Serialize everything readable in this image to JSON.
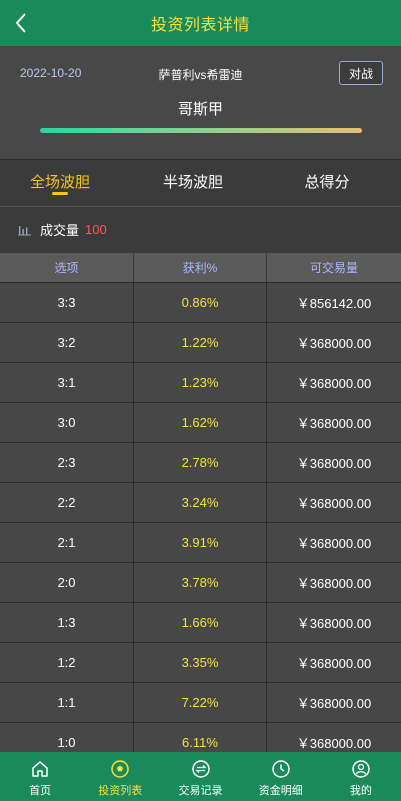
{
  "header": {
    "title": "投资列表详情"
  },
  "match": {
    "date": "2022-10-20",
    "teams": "萨普利vs希雷迪",
    "action_label": "对战",
    "league": "哥斯甲"
  },
  "tabs": [
    {
      "label": "全场波胆",
      "active": true
    },
    {
      "label": "半场波胆",
      "active": false
    },
    {
      "label": "总得分",
      "active": false
    }
  ],
  "volume": {
    "label": "成交量",
    "value": "100"
  },
  "table": {
    "headers": [
      "选项",
      "获利%",
      "可交易量"
    ],
    "rows": [
      {
        "score": "3:3",
        "profit": "0.86%",
        "amount": "￥856142.00"
      },
      {
        "score": "3:2",
        "profit": "1.22%",
        "amount": "￥368000.00"
      },
      {
        "score": "3:1",
        "profit": "1.23%",
        "amount": "￥368000.00"
      },
      {
        "score": "3:0",
        "profit": "1.62%",
        "amount": "￥368000.00"
      },
      {
        "score": "2:3",
        "profit": "2.78%",
        "amount": "￥368000.00"
      },
      {
        "score": "2:2",
        "profit": "3.24%",
        "amount": "￥368000.00"
      },
      {
        "score": "2:1",
        "profit": "3.91%",
        "amount": "￥368000.00"
      },
      {
        "score": "2:0",
        "profit": "3.78%",
        "amount": "￥368000.00"
      },
      {
        "score": "1:3",
        "profit": "1.66%",
        "amount": "￥368000.00"
      },
      {
        "score": "1:2",
        "profit": "3.35%",
        "amount": "￥368000.00"
      },
      {
        "score": "1:1",
        "profit": "7.22%",
        "amount": "￥368000.00"
      },
      {
        "score": "1:0",
        "profit": "6.11%",
        "amount": "￥368000.00"
      }
    ]
  },
  "nav": [
    {
      "label": "首页",
      "icon": "home-icon",
      "active": false
    },
    {
      "label": "投资列表",
      "icon": "soccer-ball-icon",
      "active": true
    },
    {
      "label": "交易记录",
      "icon": "exchange-icon",
      "active": false
    },
    {
      "label": "资金明细",
      "icon": "clock-icon",
      "active": false
    },
    {
      "label": "我的",
      "icon": "user-icon",
      "active": false
    }
  ],
  "colors": {
    "header_bg": "#1a8a5a",
    "accent_yellow": "#f5e23a",
    "tab_active": "#f5c518",
    "volume_value": "#ff5a5a",
    "table_header_text": "#aeb8ff"
  }
}
